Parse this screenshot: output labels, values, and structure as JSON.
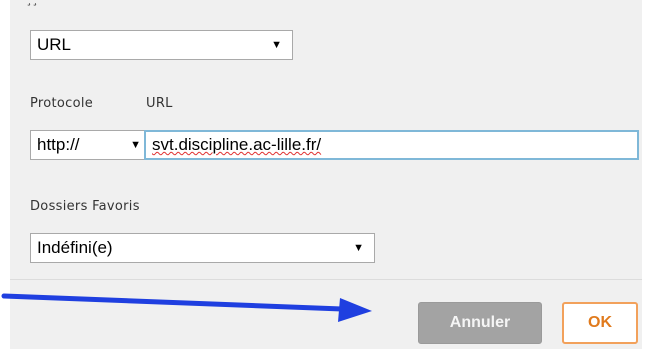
{
  "type_select": {
    "value": "URL"
  },
  "protocol": {
    "label": "Protocole",
    "value": "http://"
  },
  "url": {
    "label": "URL",
    "value": "svt.discipline.ac-lille.fr/"
  },
  "favorites": {
    "label": "Dossiers Favoris",
    "value": "Indéfini(e)"
  },
  "buttons": {
    "cancel": "Annuler",
    "ok": "OK"
  },
  "colors": {
    "arrow": "#1f3fe0",
    "ok_text": "#e07a1c",
    "cancel_bg": "#a3a3a3",
    "input_focus": "#7fb8d8"
  }
}
